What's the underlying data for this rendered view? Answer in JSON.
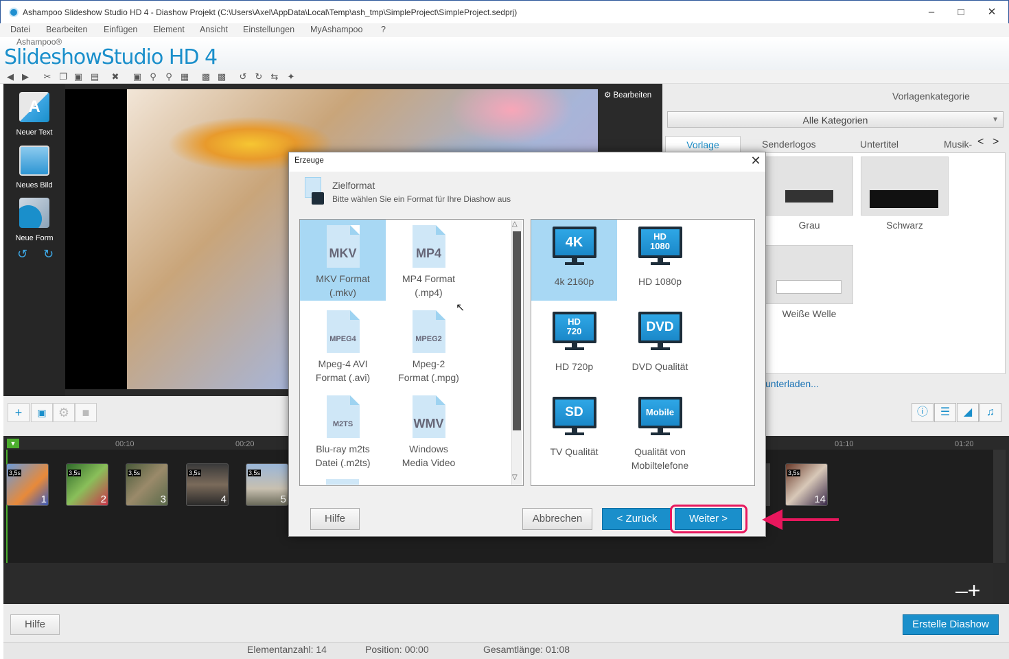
{
  "window": {
    "title": "Ashampoo Slideshow Studio HD 4 - Diashow Projekt (C:\\Users\\Axel\\AppData\\Local\\Temp\\ash_tmp\\SimpleProject\\SimpleProject.sedprj)"
  },
  "menu": [
    "Datei",
    "Bearbeiten",
    "Einfügen",
    "Element",
    "Ansicht",
    "Einstellungen",
    "MyAshampoo",
    "?"
  ],
  "logo": {
    "brand": "Ashampoo®",
    "name": "SlideshowStudio HD 4"
  },
  "sidebar": {
    "items": [
      {
        "label": "Neuer Text"
      },
      {
        "label": "Neues Bild"
      },
      {
        "label": "Neue Form"
      }
    ]
  },
  "preview": {
    "edit_label": "Bearbeiten"
  },
  "templates": {
    "category_label": "Vorlagenkategorie",
    "category_value": "Alle Kategorien",
    "tabs": [
      "Vorlage",
      "Senderlogos",
      "Untertitel",
      "Musik-"
    ],
    "items": [
      {
        "label": "Grau"
      },
      {
        "label": "Schwarz"
      },
      {
        "label": "Weiße Welle"
      }
    ],
    "download_link": "unterladen..."
  },
  "timeline": {
    "ticks": [
      "00:10",
      "00:20",
      "01:10",
      "01:20"
    ],
    "clips": [
      {
        "duration": "3,5s",
        "number": "1"
      },
      {
        "duration": "3,5s",
        "number": "2"
      },
      {
        "duration": "3,5s",
        "number": "3"
      },
      {
        "duration": "3,5s",
        "number": "4"
      },
      {
        "duration": "3,5s",
        "number": "5"
      },
      {
        "duration": "3,5s",
        "number": "14"
      }
    ]
  },
  "footer": {
    "help": "Hilfe",
    "create": "Erstelle Diashow"
  },
  "status": {
    "count": "Elementanzahl: 14",
    "position": "Position: 00:00",
    "length": "Gesamtlänge: 01:08"
  },
  "dialog": {
    "title": "Erzeuge",
    "heading": "Zielformat",
    "subheading": "Bitte wählen Sie ein Format für Ihre Diashow aus",
    "formats": [
      {
        "icon": "MKV",
        "label1": "MKV Format",
        "label2": "(.mkv)",
        "selected": true
      },
      {
        "icon": "MP4",
        "label1": "MP4 Format",
        "label2": "(.mp4)",
        "selected": false
      },
      {
        "icon": "MPEG4",
        "label1": "Mpeg-4 AVI",
        "label2": "Format (.avi)",
        "selected": false
      },
      {
        "icon": "MPEG2",
        "label1": "Mpeg-2",
        "label2": "Format (.mpg)",
        "selected": false
      },
      {
        "icon": "M2TS",
        "label1": "Blu-ray m2ts",
        "label2": "Datei (.m2ts)",
        "selected": false
      },
      {
        "icon": "WMV",
        "label1": "Windows",
        "label2": "Media Video",
        "selected": false
      }
    ],
    "qualities": [
      {
        "icon1": "4K",
        "icon2": "",
        "label1": "4k 2160p",
        "label2": "",
        "selected": true
      },
      {
        "icon1": "HD",
        "icon2": "1080",
        "label1": "HD 1080p",
        "label2": "",
        "selected": false
      },
      {
        "icon1": "HD",
        "icon2": "720",
        "label1": "HD 720p",
        "label2": "",
        "selected": false
      },
      {
        "icon1": "DVD",
        "icon2": "",
        "label1": "DVD Qualität",
        "label2": "",
        "selected": false
      },
      {
        "icon1": "SD",
        "icon2": "",
        "label1": "TV Qualität",
        "label2": "",
        "selected": false
      },
      {
        "icon1": "Mobile",
        "icon2": "",
        "label1": "Qualität von",
        "label2": "Mobiltelefone",
        "selected": false
      }
    ],
    "buttons": {
      "help": "Hilfe",
      "cancel": "Abbrechen",
      "back": "< Zurück",
      "next": "Weiter >"
    }
  },
  "colors": {
    "accent": "#1a8fcb",
    "highlight": "#e8175d"
  }
}
